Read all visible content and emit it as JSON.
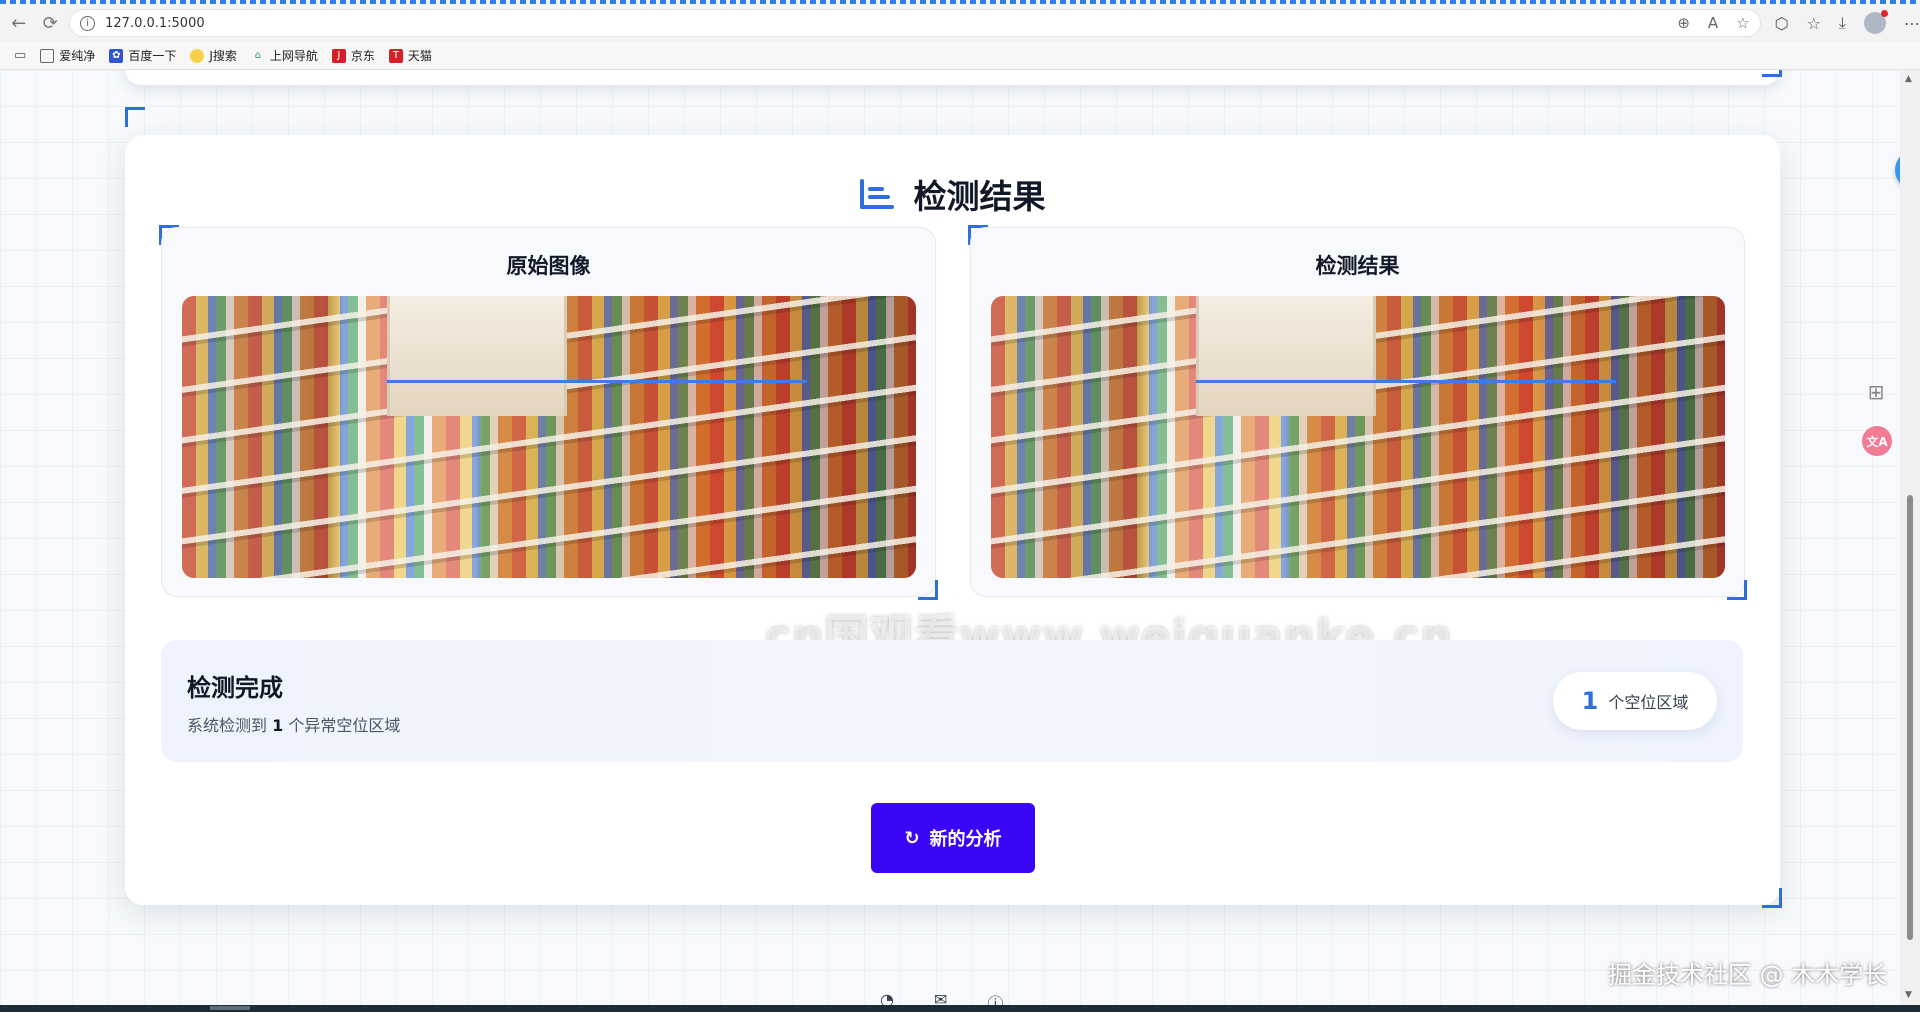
{
  "browser": {
    "url": "127.0.0.1:5000",
    "bookmarks": [
      {
        "label": "爱纯净",
        "icon": "folder-icon"
      },
      {
        "label": "百度一下",
        "icon": "baidu-paw-icon"
      },
      {
        "label": "J搜索",
        "icon": "search-logo-icon"
      },
      {
        "label": "上网导航",
        "icon": "house-icon"
      },
      {
        "label": "京东",
        "icon": "jd-logo-icon"
      },
      {
        "label": "天猫",
        "icon": "tmall-logo-icon"
      }
    ]
  },
  "results": {
    "title": "检测结果",
    "original_panel_title": "原始图像",
    "result_panel_title": "检测结果",
    "watermark": "cn国观看www.weiguanke.cn",
    "status": {
      "heading": "检测完成",
      "desc_prefix": "系统检测到 ",
      "count": "1",
      "desc_suffix": " 个异常空位区域",
      "pill_count": "1",
      "pill_label": "个空位区域"
    },
    "new_button_label": "新的分析"
  },
  "overlay": {
    "translate_label": "文A",
    "footer_credit": "掘金技术社区 @ 木木学长"
  },
  "colors": {
    "accent": "#2f6fdc",
    "button": "#3b06f5"
  }
}
